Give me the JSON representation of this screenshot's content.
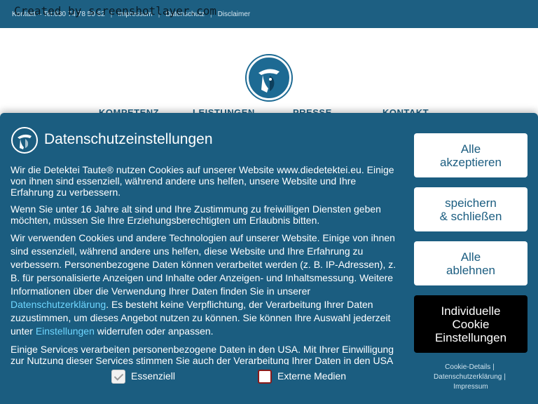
{
  "watermark": "Created by screenshotlayer.com",
  "topbar": {
    "contact": "Kontakt – Tel.030 74 78 50 62",
    "impressum": "Impressum",
    "datenschutz": "Datenschutz",
    "disclaimer": "Disclaimer"
  },
  "nav": {
    "items": [
      "KOMPETENZ",
      "LEISTUNGEN",
      "PRESSE",
      "KONTAKT"
    ]
  },
  "consent": {
    "title": "Datenschutzeinstellungen",
    "p1": "Wir die Detektei Taute® nutzen Cookies auf unserer Website www.diedetektei.eu. Einige von ihnen sind essenziell, während andere uns helfen, unsere Website und Ihre Erfahrung zu verbessern.",
    "p2": "Wenn Sie unter 16 Jahre alt sind und Ihre Zustimmung zu freiwilligen Diensten geben möchten, müssen Sie Ihre Erziehungsberechtigten um Erlaubnis bitten.",
    "p3_a": "Wir verwenden Cookies und andere Technologien auf unserer Website. Einige von ihnen sind essenziell, während andere uns helfen, diese Website und Ihre Erfahrung zu verbessern. Personenbezogene Daten können verarbeitet werden (z. B. IP-Adressen), z. B. für personalisierte Anzeigen und Inhalte oder Anzeigen- und Inhaltsmessung. Weitere Informationen über die Verwendung Ihrer Daten finden Sie in unserer ",
    "p3_link1": "Datenschutzerklärung",
    "p3_b": ". Es besteht keine Verpflichtung, der Verarbeitung Ihrer Daten zuzustimmen, um dieses Angebot nutzen zu können. Sie können Ihre Auswahl jederzeit unter ",
    "p3_link2": "Einstellungen",
    "p3_c": " widerrufen oder anpassen.",
    "p4": "Einige Services verarbeiten personenbezogene Daten in den USA. Mit Ihrer Einwilligung zur Nutzung dieser Services stimmen Sie auch der Verarbeitung Ihrer Daten in den USA",
    "checkbox_essential": "Essenziell",
    "checkbox_external": "Externe Medien",
    "btn_accept": [
      "Alle",
      "akzeptieren"
    ],
    "btn_save": [
      "speichern",
      "& schließen"
    ],
    "btn_reject": [
      "Alle",
      "ablehnen"
    ],
    "btn_individual": [
      "Individuelle",
      "Cookie",
      "Einstellungen"
    ],
    "links": {
      "cookie_details": "Cookie-Details",
      "privacy": "Datenschutzerklärung",
      "imprint": "Impressum"
    }
  },
  "colors": {
    "brand_blue": "#1b5d80",
    "link_cyan": "#6fd6ff",
    "button_dark": "#000000"
  }
}
